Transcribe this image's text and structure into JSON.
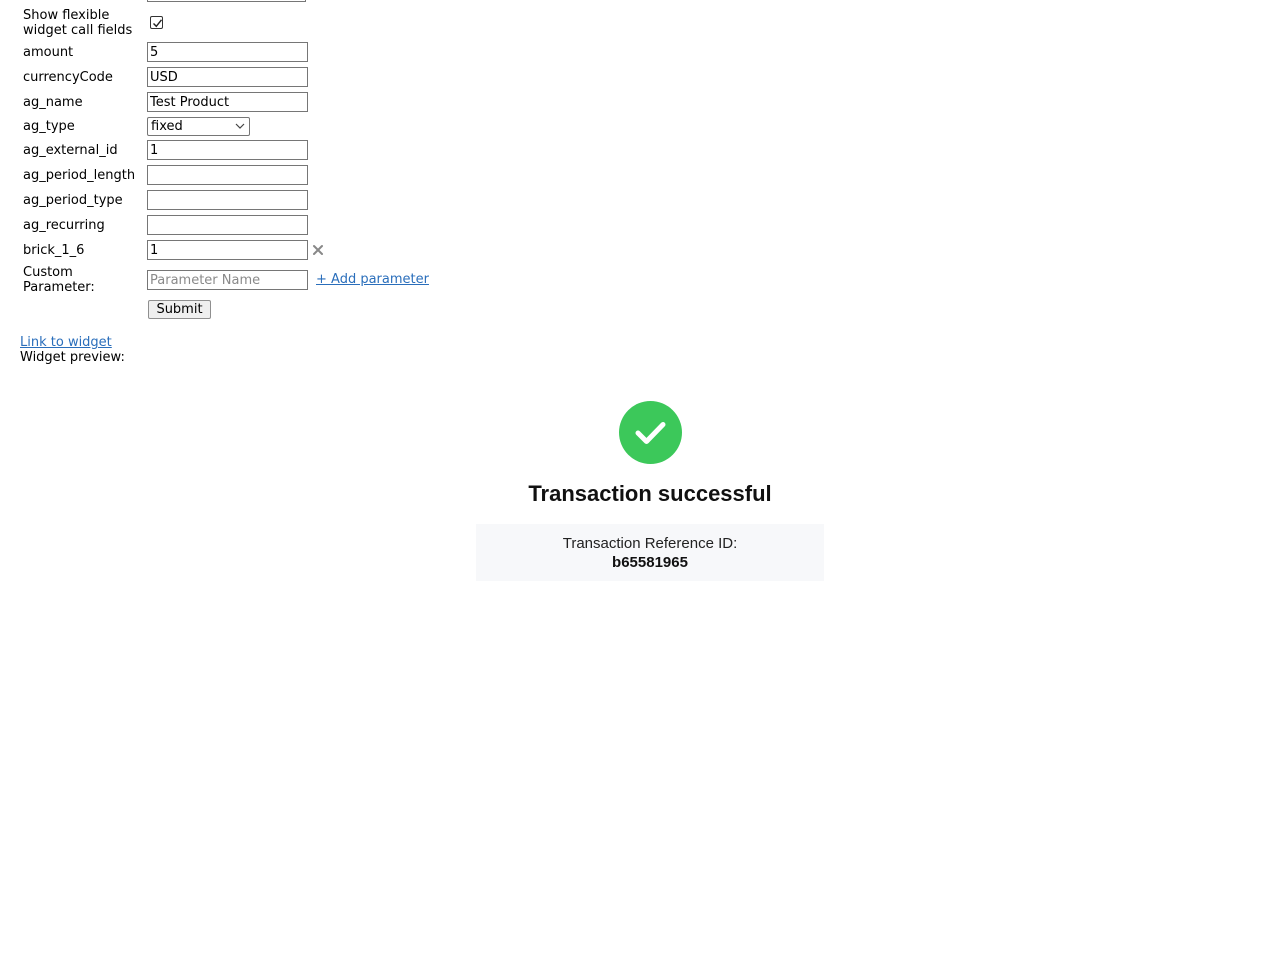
{
  "form": {
    "show_flexible_label": "Show flexible widget call fields",
    "show_flexible_checked": true,
    "fields": {
      "amount": {
        "label": "amount",
        "value": "5"
      },
      "currency": {
        "label": "currencyCode",
        "value": "USD"
      },
      "ag_name": {
        "label": "ag_name",
        "value": "Test Product"
      },
      "ag_type": {
        "label": "ag_type",
        "value": "fixed"
      },
      "ag_external_id": {
        "label": "ag_external_id",
        "value": "1"
      },
      "ag_period_length": {
        "label": "ag_period_length",
        "value": ""
      },
      "ag_period_type": {
        "label": "ag_period_type",
        "value": ""
      },
      "ag_recurring": {
        "label": "ag_recurring",
        "value": ""
      },
      "brick_1_6": {
        "label": "brick_1_6",
        "value": "1"
      }
    },
    "custom_parameter": {
      "label": "Custom Parameter:",
      "placeholder": "Parameter Name",
      "add_link": "+ Add parameter"
    },
    "submit_label": "Submit"
  },
  "links": {
    "link_to_widget": "Link to widget"
  },
  "preview": {
    "label": "Widget preview:",
    "success_title": "Transaction successful",
    "reference_label": "Transaction Reference ID:",
    "reference_id": "b65581965",
    "success_color": "#3cc85a"
  },
  "icons": {
    "checkbox": "checkmark-icon",
    "select": "chevron-down-icon",
    "remove": "close-icon",
    "success": "check-circle-icon"
  }
}
